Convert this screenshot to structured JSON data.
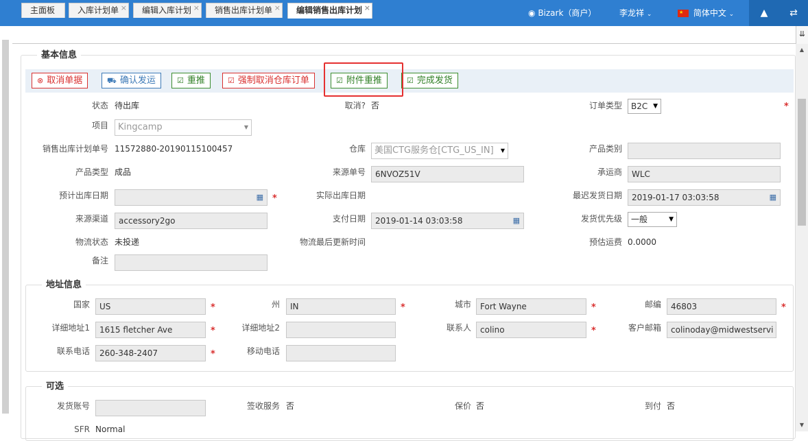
{
  "topbar": {
    "company": "Bizark（商户）",
    "user": "李龙祥",
    "language": "简体中文",
    "tree_icon": "tree-icon",
    "swap_icon": "swap-icon"
  },
  "tabs": [
    {
      "label": "主面板"
    },
    {
      "label": "入库计划单"
    },
    {
      "label": "编辑入库计划"
    },
    {
      "label": "销售出库计划单"
    },
    {
      "label": "编辑销售出库计划"
    }
  ],
  "basic": {
    "legend": "基本信息",
    "buttons": {
      "cancel_order": "取消单据",
      "confirm_ship": "确认发运",
      "repush": "重推",
      "force_cancel": "强制取消仓库订单",
      "attach_repush": "附件重推",
      "complete_ship": "完成发货"
    },
    "labels": {
      "status": "状态",
      "cancelled": "取消?",
      "order_type": "订单类型",
      "project": "项目",
      "plan_no": "销售出库计划单号",
      "warehouse": "仓库",
      "product_category": "产品类别",
      "product_type": "产品类型",
      "source_no": "来源单号",
      "carrier": "承运商",
      "planned_date": "预计出库日期",
      "actual_date": "实际出库日期",
      "latest_ship_date": "最迟发货日期",
      "source_channel": "来源渠道",
      "pay_date": "支付日期",
      "ship_priority": "发货优先级",
      "logistics_status": "物流状态",
      "logistics_update": "物流最后更新时间",
      "est_freight": "预估运费",
      "remark": "备注"
    },
    "values": {
      "status": "待出库",
      "cancelled": "否",
      "order_type": "B2C",
      "project": "Kingcamp",
      "plan_no": "11572880-20190115100457",
      "warehouse": "美国CTG服务仓[CTG_US_IN]",
      "product_category": "",
      "product_type": "成品",
      "source_no": "6NVOZ51V",
      "carrier": "WLC",
      "planned_date": "",
      "actual_date": "",
      "latest_ship_date": "2019-01-17 03:03:58",
      "source_channel": "accessory2go",
      "pay_date": "2019-01-14 03:03:58",
      "ship_priority": "一般",
      "logistics_status": "未投递",
      "logistics_update": "",
      "est_freight": "0.0000",
      "remark": ""
    }
  },
  "address": {
    "legend": "地址信息",
    "labels": {
      "country": "国家",
      "state": "州",
      "city": "城市",
      "zip": "邮编",
      "address1": "详细地址1",
      "address2": "详细地址2",
      "contact": "联系人",
      "email": "客户邮箱",
      "phone": "联系电话",
      "mobile": "移动电话"
    },
    "values": {
      "country": "US",
      "state": "IN",
      "city": "Fort Wayne",
      "zip": "46803",
      "address1": "1615 fletcher Ave",
      "address2": "",
      "contact": "colino",
      "email": "colinoday@midwestservi",
      "phone": "260-348-2407",
      "mobile": ""
    }
  },
  "optional": {
    "legend": "可选",
    "labels": {
      "ship_account": "发货账号",
      "signature": "签收服务",
      "insurance": "保价",
      "cod": "到付",
      "sfr": "SFR"
    },
    "values": {
      "ship_account": "",
      "signature": "否",
      "insurance": "否",
      "cod": "否",
      "sfr": "Normal"
    }
  },
  "required_mark": "*"
}
